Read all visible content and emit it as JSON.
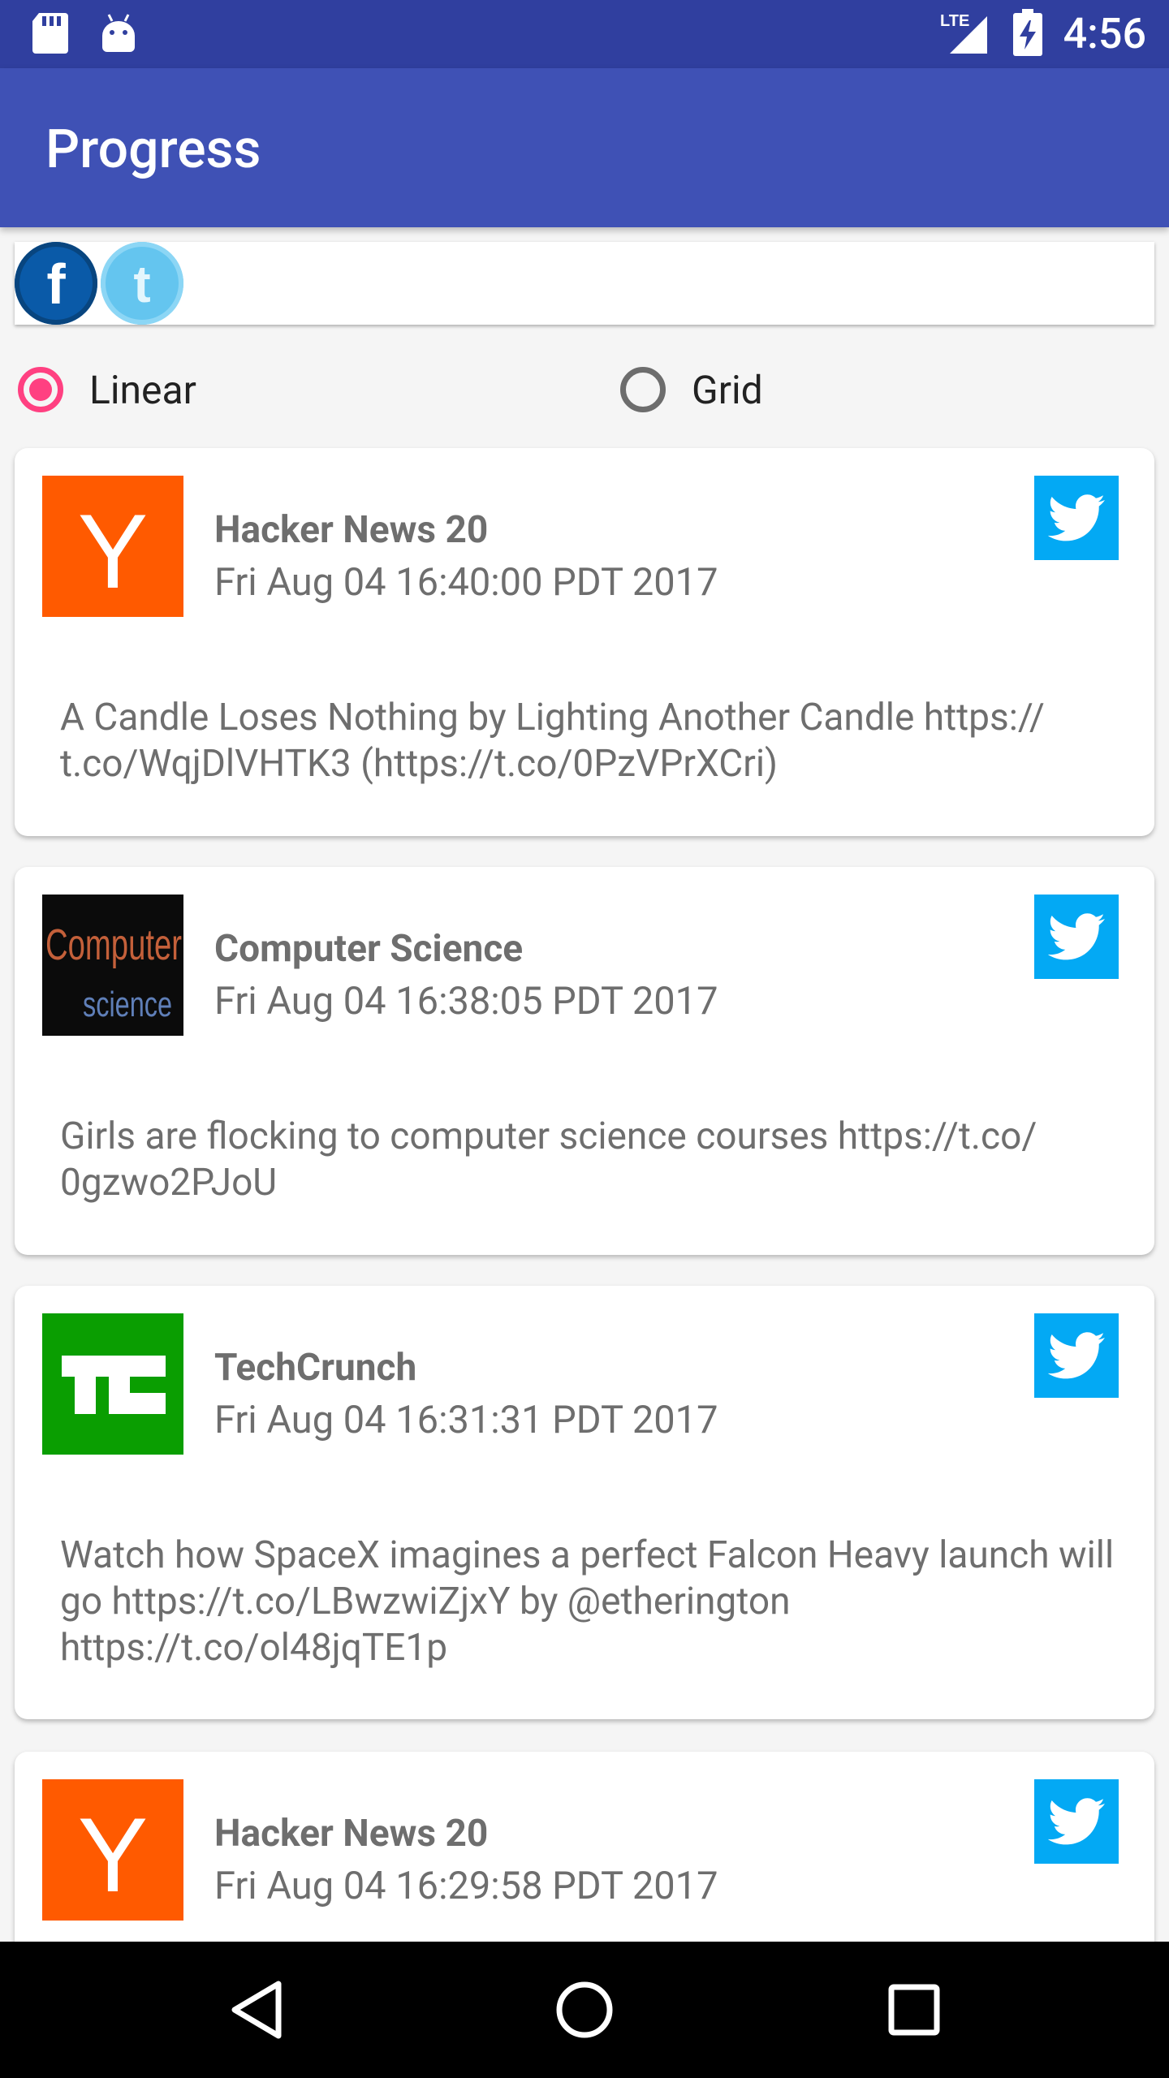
{
  "status_bar": {
    "network": "LTE",
    "time": "4:56",
    "icons": [
      "sd-card-icon",
      "android-icon",
      "signal-icon",
      "battery-icon"
    ]
  },
  "app_bar": {
    "title": "Progress",
    "color": "#3f51b5"
  },
  "social": {
    "buttons": [
      "facebook",
      "twitter"
    ]
  },
  "layout_options": {
    "selected": "Linear",
    "options": [
      "Linear",
      "Grid"
    ],
    "accent": "#ff4081"
  },
  "feed": [
    {
      "source": "Hacker News 20",
      "date": "Fri Aug 04 16:40:00 PDT 2017",
      "text": "A Candle Loses Nothing by Lighting Another Candle https:// t.co/WqjDlVHTK3 (https://t.co/0PzVPrXCri)",
      "avatar": "hacker-news-logo"
    },
    {
      "source": "Computer Science",
      "date": "Fri Aug 04 16:38:05 PDT 2017",
      "text": "Girls are flocking to computer science courses https://t.co/ 0gzwo2PJoU",
      "avatar": "computer-science-logo",
      "avatar_text_1": "Computer",
      "avatar_text_2": "science"
    },
    {
      "source": "TechCrunch",
      "date": "Fri Aug 04 16:31:31 PDT 2017",
      "text": "Watch how SpaceX imagines a perfect Falcon Heavy launch will go https://t.co/LBwzwiZjxY by @etherington https://t.co/ol48jqTE1p",
      "avatar": "techcrunch-logo"
    },
    {
      "source": "Hacker News 20",
      "date": "Fri Aug 04 16:29:58 PDT 2017",
      "avatar": "hacker-news-logo"
    }
  ],
  "nav_bar": {
    "buttons": [
      "back",
      "home",
      "recents"
    ]
  }
}
